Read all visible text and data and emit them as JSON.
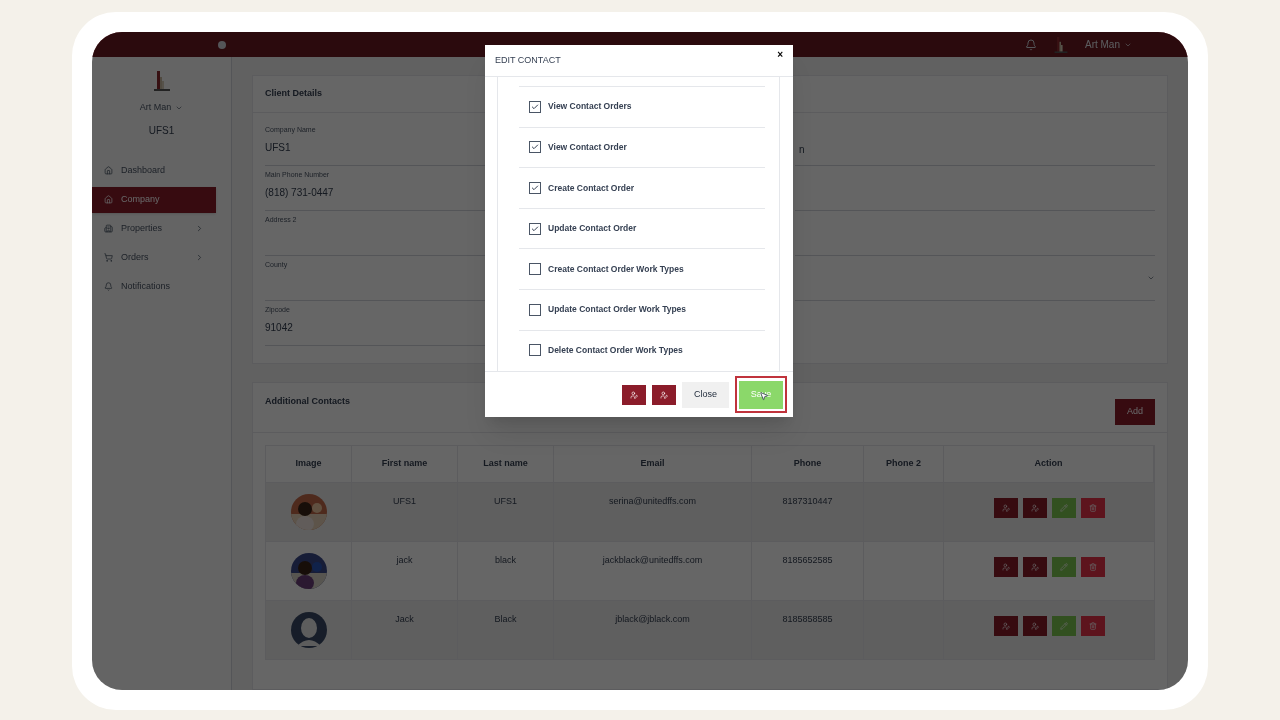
{
  "top_bar": {
    "user": "Art Man"
  },
  "sidebar": {
    "user": "Art Man",
    "company": "UFS1",
    "items": [
      {
        "label": "Dashboard",
        "kind": "home",
        "selected": false,
        "has_submenu": false
      },
      {
        "label": "Company",
        "kind": "home",
        "selected": true,
        "has_submenu": false
      },
      {
        "label": "Properties",
        "kind": "building",
        "selected": false,
        "has_submenu": true
      },
      {
        "label": "Orders",
        "kind": "cart",
        "selected": false,
        "has_submenu": true
      },
      {
        "label": "Notifications",
        "kind": "bell",
        "selected": false,
        "has_submenu": false
      }
    ]
  },
  "client_details": {
    "title": "Client Details",
    "rows": [
      {
        "label": "Company Name",
        "value": "UFS1",
        "right": {
          "kind": "text",
          "value": "n"
        }
      },
      {
        "label": "Main Phone Number",
        "value": "(818) 731-0447",
        "right": {
          "kind": "text"
        }
      },
      {
        "label": "Address 2",
        "right": {
          "kind": "text"
        }
      },
      {
        "label": "County",
        "right": {
          "kind": "select"
        }
      },
      {
        "label": "Zipcode",
        "value": "91042",
        "right": {
          "kind": "none"
        }
      }
    ]
  },
  "additional_contacts": {
    "title": "Additional Contacts",
    "add_button": "Add",
    "table": {
      "columns": [
        "Image",
        "First name",
        "Last name",
        "Email",
        "Phone",
        "Phone 2",
        "Action"
      ],
      "rows": [
        {
          "first_name": "UFS1",
          "last_name": "UFS1",
          "email": "serina@unitedffs.com",
          "phone": "8187310447"
        },
        {
          "first_name": "jack",
          "last_name": "black",
          "email": "jackblack@unitedffs.com",
          "phone": "8185652585"
        },
        {
          "kind": "silhouette",
          "first_name": "Jack",
          "last_name": "Black",
          "email": "jblack@jblack.com",
          "phone": "8185858585"
        }
      ]
    }
  },
  "modal": {
    "title": "EDIT CONTACT",
    "close": "×",
    "permissions": [
      {
        "label": "View Contact Orders",
        "checked": true
      },
      {
        "label": "View Contact Order",
        "checked": true
      },
      {
        "label": "Create Contact Order",
        "checked": true
      },
      {
        "label": "Update Contact Order",
        "checked": true
      },
      {
        "label": "Create Contact Order Work Types",
        "checked": false
      },
      {
        "label": "Update Contact Order Work Types",
        "checked": false
      },
      {
        "label": "Delete Contact Order Work Types",
        "checked": false
      }
    ],
    "buttons": [
      {
        "kind": "icon"
      },
      {
        "kind": "icon"
      },
      {
        "kind": "text",
        "label": "Close"
      },
      {
        "kind": "primary",
        "label": "Save",
        "highlighted": true
      }
    ]
  }
}
